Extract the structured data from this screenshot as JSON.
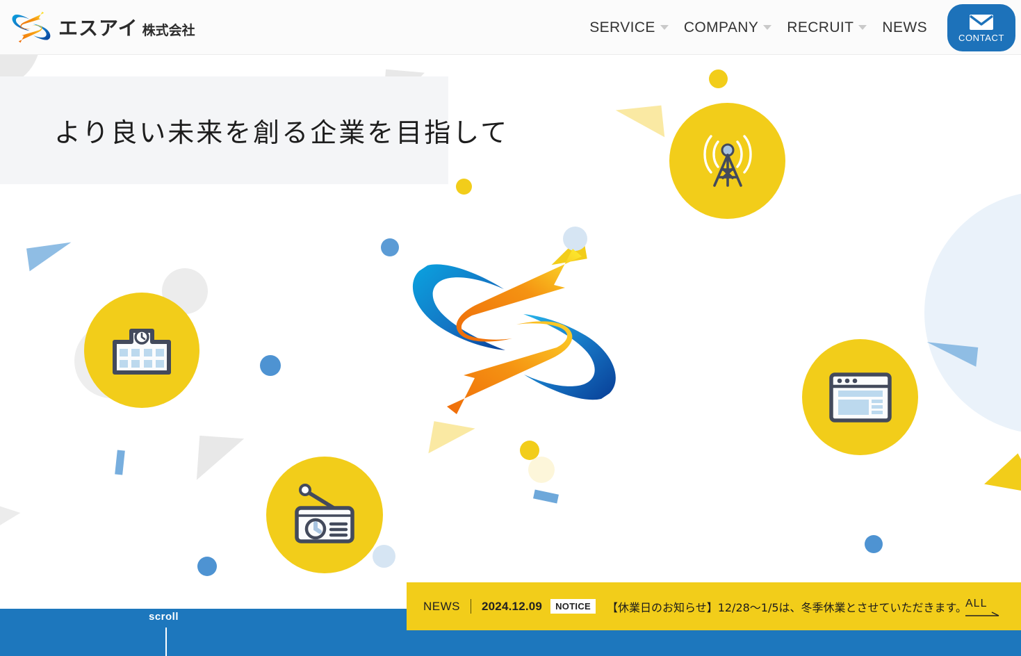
{
  "header": {
    "logo": {
      "icon": "company-s-mark",
      "kana": "エスアイ",
      "suffix": "株式会社"
    },
    "nav": [
      {
        "label": "SERVICE",
        "has_dropdown": true
      },
      {
        "label": "COMPANY",
        "has_dropdown": true
      },
      {
        "label": "RECRUIT",
        "has_dropdown": true
      },
      {
        "label": "NEWS",
        "has_dropdown": false
      }
    ],
    "contact": {
      "label": "CONTACT",
      "icon": "envelope-icon",
      "bg": "#1d72ba"
    }
  },
  "hero": {
    "heading": "より良い未来を創る企業を目指して",
    "panel_bg": "#f4f5f7",
    "center_logo_alt": "S mark logo",
    "bubbles": [
      {
        "name": "antenna-tower-icon",
        "label": "antenna-tower"
      },
      {
        "name": "school-building-icon",
        "label": "school-building"
      },
      {
        "name": "radio-receiver-icon",
        "label": "radio-receiver"
      },
      {
        "name": "browser-window-icon",
        "label": "browser-window"
      }
    ]
  },
  "footer": {
    "scroll_label": "scroll",
    "band_color": "#1d77bd"
  },
  "news": {
    "tag": "NEWS",
    "date": "2024.12.09",
    "category": "NOTICE",
    "text": "【休業日のお知らせ】12/28〜1/5は、冬季休業とさせていただきます。",
    "all_label": "ALL",
    "bg": "#f2cd1a"
  },
  "colors": {
    "brand_blue": "#1d77bd",
    "brand_yellow": "#f2cd1a",
    "logo_orange": "#ef7f1a",
    "ink": "#434a5c"
  }
}
